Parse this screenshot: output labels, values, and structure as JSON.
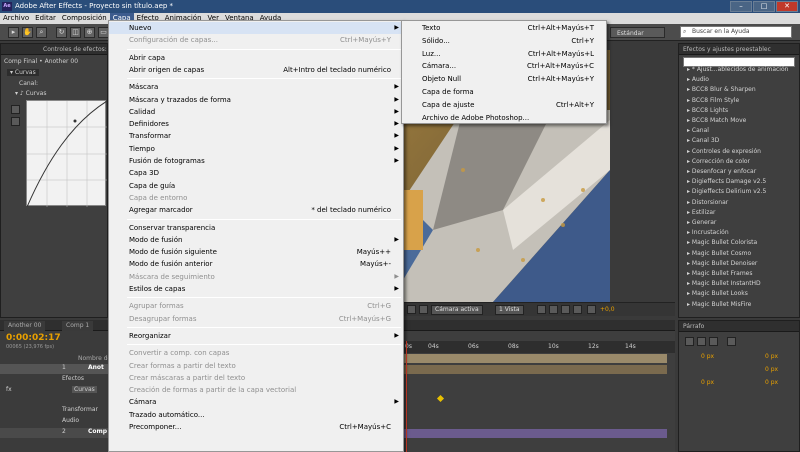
{
  "window": {
    "title": "Adobe After Effects - Proyecto sin título.aep *",
    "logo": "Ae"
  },
  "menubar": [
    "Archivo",
    "Editar",
    "Composición",
    "Capa",
    "Efecto",
    "Animación",
    "Ver",
    "Ventana",
    "Ayuda"
  ],
  "workspace": {
    "label": "Estándar"
  },
  "search": {
    "placeholder": "Buscar en la Ayuda"
  },
  "effect_controls": {
    "header": "Controles de efectos:",
    "subheader": "Comp Final • Another 00",
    "effect_name": "Curvas",
    "channel_label": "Canal:",
    "curves_label": "Curvas"
  },
  "effects_panel": {
    "header": "Efectos y ajustes preestablec",
    "items": [
      "* Ajust...ablecidos de animación",
      "Audio",
      "BCC8 Blur & Sharpen",
      "BCC8 Film Style",
      "BCC8 Lights",
      "BCC8 Match Move",
      "Canal",
      "Canal 3D",
      "Controles de expresión",
      "Corrección de color",
      "Desenfocar y enfocar",
      "Digieffects Damage v2.5",
      "Digieffects Delirium v2.5",
      "Distorsionar",
      "Estilizar",
      "Generar",
      "Incrustación",
      "Magic Bullet Colorista",
      "Magic Bullet Cosmo",
      "Magic Bullet Denoiser",
      "Magic Bullet Frames",
      "Magic Bullet InstantHD",
      "Magic Bullet Looks",
      "Magic Bullet MisFire"
    ]
  },
  "viewer_bar": {
    "camera": "Cámara activa",
    "views": "1 Vista",
    "exposure": "+0,0"
  },
  "timeline": {
    "tabs": [
      "Another 00",
      "Comp 1"
    ],
    "timecode": "0:00:02:17",
    "fps": "00065 (23,976 fps)",
    "col_name": "Nombre de",
    "layers": [
      {
        "num": "1",
        "name": "Anot"
      },
      {
        "num": "",
        "name": "Efectos"
      },
      {
        "num": "",
        "name": "Curvas"
      },
      {
        "num": "",
        "name": "Transformar"
      },
      {
        "num": "",
        "name": "Audio"
      },
      {
        "num": "2",
        "name": "Comp"
      }
    ],
    "ruler": [
      "0s",
      "04s",
      "06s",
      "08s",
      "10s",
      "12s",
      "14s"
    ],
    "fx_label": "fx"
  },
  "paragraph": {
    "header": "Párrafo",
    "px": [
      "0 px",
      "0 px",
      "0 px",
      "0 px",
      "0 px"
    ]
  },
  "layer_menu": {
    "items": [
      {
        "label": "Nuevo",
        "shortcut": "",
        "submenu": true,
        "disabled": false,
        "highlight": true
      },
      {
        "label": "Configuración de capas...",
        "shortcut": "Ctrl+Mayús+Y",
        "disabled": true
      },
      {
        "sep": true
      },
      {
        "label": "Abrir capa",
        "shortcut": ""
      },
      {
        "label": "Abrir origen de capas",
        "shortcut": "Alt+Intro del teclado numérico"
      },
      {
        "sep": true
      },
      {
        "label": "Máscara",
        "submenu": true
      },
      {
        "label": "Máscara y trazados de forma",
        "submenu": true
      },
      {
        "label": "Calidad",
        "submenu": true
      },
      {
        "label": "Definidores",
        "submenu": true
      },
      {
        "label": "Transformar",
        "submenu": true
      },
      {
        "label": "Tiempo",
        "submenu": true
      },
      {
        "label": "Fusión de fotogramas",
        "submenu": true
      },
      {
        "label": "Capa 3D"
      },
      {
        "label": "Capa de guía"
      },
      {
        "label": "Capa de entorno",
        "disabled": true
      },
      {
        "label": "Agregar marcador",
        "shortcut": "* del teclado numérico"
      },
      {
        "sep": true
      },
      {
        "label": "Conservar transparencia"
      },
      {
        "label": "Modo de fusión",
        "submenu": true
      },
      {
        "label": "Modo de fusión siguiente",
        "shortcut": "Mayús++"
      },
      {
        "label": "Modo de fusión anterior",
        "shortcut": "Mayús+-"
      },
      {
        "label": "Máscara de seguimiento",
        "submenu": true,
        "disabled": true
      },
      {
        "label": "Estilos de capas",
        "submenu": true
      },
      {
        "sep": true
      },
      {
        "label": "Agrupar formas",
        "shortcut": "Ctrl+G",
        "disabled": true
      },
      {
        "label": "Desagrupar formas",
        "shortcut": "Ctrl+Mayús+G",
        "disabled": true
      },
      {
        "sep": true
      },
      {
        "label": "Reorganizar",
        "submenu": true
      },
      {
        "sep": true
      },
      {
        "label": "Convertir a comp. con capas",
        "disabled": true
      },
      {
        "label": "Crear formas a partir del texto",
        "disabled": true
      },
      {
        "label": "Crear máscaras a partir del texto",
        "disabled": true
      },
      {
        "label": "Creación de formas a partir de la capa vectorial",
        "disabled": true
      },
      {
        "label": "Cámara",
        "submenu": true
      },
      {
        "label": "Trazado automático..."
      },
      {
        "label": "Precomponer...",
        "shortcut": "Ctrl+Mayús+C"
      }
    ]
  },
  "new_submenu": {
    "items": [
      {
        "label": "Texto",
        "shortcut": "Ctrl+Alt+Mayús+T"
      },
      {
        "label": "Sólido...",
        "shortcut": "Ctrl+Y"
      },
      {
        "label": "Luz...",
        "shortcut": "Ctrl+Alt+Mayús+L"
      },
      {
        "label": "Cámara...",
        "shortcut": "Ctrl+Alt+Mayús+C"
      },
      {
        "label": "Objeto Null",
        "shortcut": "Ctrl+Alt+Mayús+Y"
      },
      {
        "label": "Capa de forma",
        "shortcut": ""
      },
      {
        "label": "Capa de ajuste",
        "shortcut": "Ctrl+Alt+Y"
      },
      {
        "label": "Archivo de Adobe Photoshop...",
        "shortcut": ""
      }
    ]
  },
  "colors": {
    "menu_bg": "#f0f0f0",
    "highlight": "#d7e3f4",
    "accent_orange": "#e8a000",
    "title_blue": "#2a4d7a"
  }
}
